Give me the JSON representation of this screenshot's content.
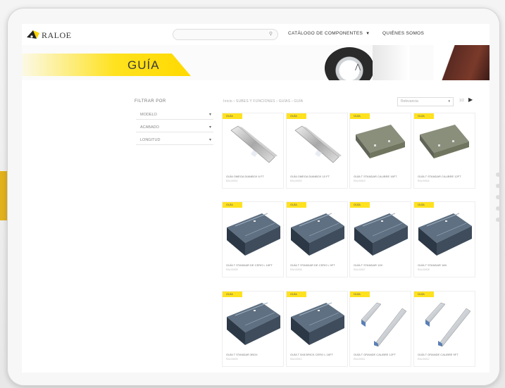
{
  "header": {
    "logo_text": "RALOE",
    "search_placeholder": "",
    "nav_catalog": "CATÁLOGO DE COMPONENTES",
    "nav_about": "QUIÉNES SOMOS"
  },
  "banner": {
    "title": "GUÍA"
  },
  "filters": {
    "title": "FILTRAR POR",
    "items": [
      {
        "label": "MODELO"
      },
      {
        "label": "ACABADO"
      },
      {
        "label": "LONGITUD"
      }
    ]
  },
  "breadcrumb": "Inicio  ›  SUBES Y FUNCIONES  ›  GUÍAS  ›  GUÍA",
  "sort": {
    "label": "Relevancia"
  },
  "pagination": {
    "page": "1/2",
    "next_icon": "chevron-right-icon"
  },
  "products": [
    {
      "tag": "GUÍA",
      "name": "GUÍA OMEGA DIANBOX 6 FT",
      "sku": "RAL00001",
      "image": "omega-rail"
    },
    {
      "tag": "GUÍA",
      "name": "GUÍA OMEGA DIANBOX 10 FT",
      "sku": "RAL00002",
      "image": "omega-rail"
    },
    {
      "tag": "GUÍA",
      "name": "GUÍA T STANDAR CALIBRE 16FT",
      "sku": "RAL00003",
      "image": "t-rail"
    },
    {
      "tag": "GUÍA",
      "name": "GUÍA T STANDAR CALIBRE 12FT",
      "sku": "RAL00004",
      "image": "t-rail"
    },
    {
      "tag": "GUÍA",
      "name": "GUÍA T STANDAR DE CERO L 16FT",
      "sku": "RAL00005",
      "image": "box-rail"
    },
    {
      "tag": "GUÍA",
      "name": "GUÍA T STANDAR DE CERO L 9FT",
      "sku": "RAL00006",
      "image": "box-rail"
    },
    {
      "tag": "GUÍA",
      "name": "GUÍA T STANDAR 12ft",
      "sku": "RAL00007",
      "image": "box-rail"
    },
    {
      "tag": "GUÍA",
      "name": "GUÍA T STANDAR 16ft",
      "sku": "RAL00008",
      "image": "box-rail"
    },
    {
      "tag": "GUÍA",
      "name": "GUÍA T STANDAR 3BOX",
      "sku": "RAL00009",
      "image": "box-rail"
    },
    {
      "tag": "GUÍA",
      "name": "GUÍA T 5X8 BRICK CERO L 16FT",
      "sku": "RAL00010",
      "image": "box-rail"
    },
    {
      "tag": "GUÍA",
      "name": "GUÍA T GRANDE CALIBRE 12FT",
      "sku": "RAL00011",
      "image": "twin-rail"
    },
    {
      "tag": "GUÍA",
      "name": "GUÍA T GRANDE CALIBRE 9FT",
      "sku": "RAL00012",
      "image": "twin-rail"
    }
  ],
  "colors": {
    "accent": "#ffe21f",
    "text": "#333333",
    "muted": "#999999"
  }
}
